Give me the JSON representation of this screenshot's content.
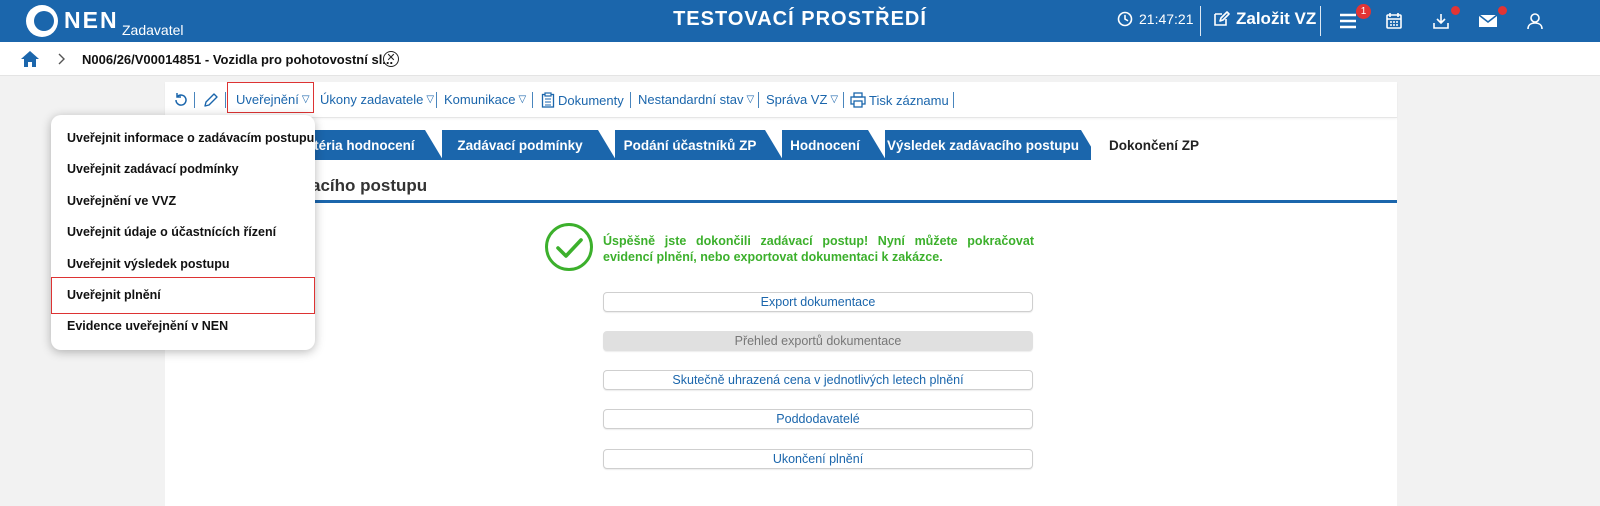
{
  "header": {
    "logo_text": "NEN",
    "logo_subtitle": "Zadavatel",
    "environment_title": "TESTOVACÍ PROSTŘEDÍ",
    "clock": "21:47:21",
    "create_label": "Založit VZ",
    "menu_badge": "1"
  },
  "breadcrumb": {
    "current": "N006/26/V00014851 - Vozidla pro pohotovostní sl..."
  },
  "toolbar": {
    "publish_label": "Uveřejnění",
    "actions_label": "Úkony zadavatele",
    "communication_label": "Komunikace",
    "documents_label": "Dokumenty",
    "nonstandard_label": "Nestandardní stav",
    "management_label": "Správa VZ",
    "print_label": "Tisk záznamu"
  },
  "tabs": [
    {
      "label": "Kritéria hodnocení"
    },
    {
      "label": "Zadávací podmínky"
    },
    {
      "label": "Podání účastníků ZP"
    },
    {
      "label": "Hodnocení"
    },
    {
      "label": "Výsledek zadávacího postupu"
    },
    {
      "label": "Dokončení ZP"
    }
  ],
  "section": {
    "title_fragment": "acího postupu"
  },
  "success": {
    "message": "Úspěšně jste dokončili zadávací postup! Nyní můžete pokračovat evidencí plnění, nebo exportovat dokumentaci k zakázce."
  },
  "actions": [
    {
      "label": "Export dokumentace",
      "disabled": false
    },
    {
      "label": "Přehled exportů dokumentace",
      "disabled": true
    },
    {
      "label": "Skutečně uhrazená cena v jednotlivých letech plnění",
      "disabled": false
    },
    {
      "label": "Poddodavatelé",
      "disabled": false
    },
    {
      "label": "Ukončení plnění",
      "disabled": false
    }
  ],
  "dropdown": {
    "items": [
      {
        "label": "Uveřejnit informace o zadávacím postupu"
      },
      {
        "label": "Uveřejnit zadávací podmínky"
      },
      {
        "label": "Uveřejnění ve VVZ"
      },
      {
        "label": "Uveřejnit údaje o účastnících řízení"
      },
      {
        "label": "Uveřejnit výsledek postupu"
      },
      {
        "label": "Uveřejnit plnění"
      },
      {
        "label": "Evidence uveřejnění v NEN"
      }
    ]
  },
  "colors": {
    "brand_blue": "#1b66ac",
    "success_green": "#3cb02c",
    "highlight_red": "#d33333",
    "badge_red": "#e23434"
  }
}
